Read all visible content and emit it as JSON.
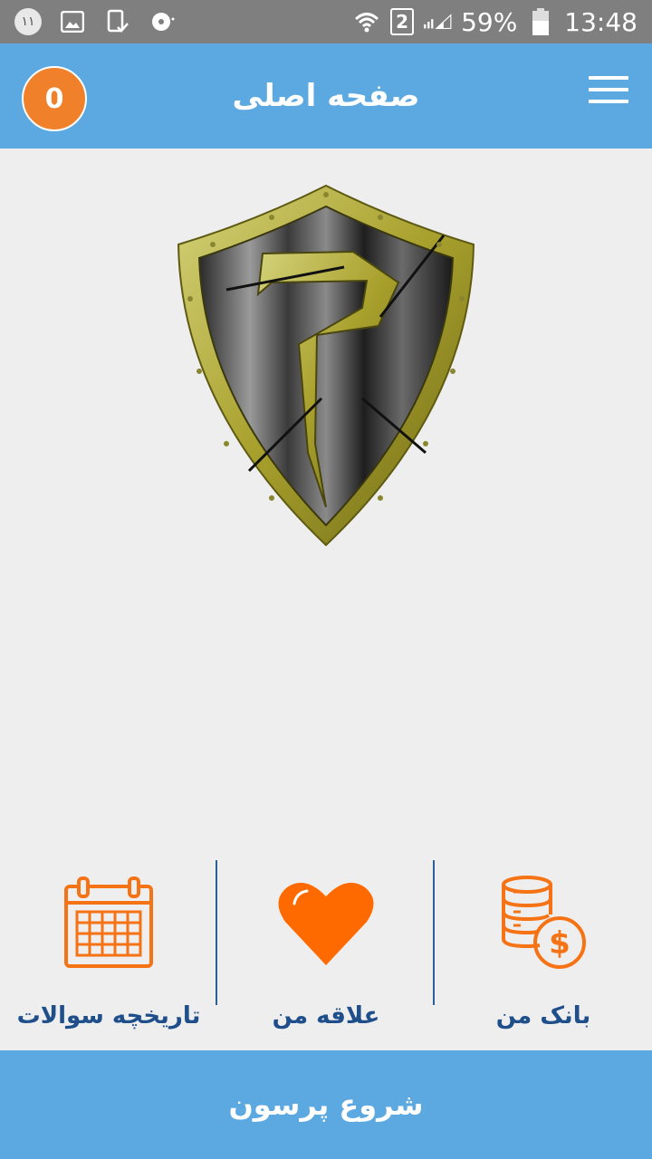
{
  "status_bar": {
    "notification_count": "۱۱",
    "sim_slot": "2",
    "battery": "59%",
    "time": "13:48"
  },
  "appbar": {
    "title": "صفحه اصلی",
    "coins": "0"
  },
  "actions": [
    {
      "label": "تاریخچه سوالات",
      "icon": "calendar-icon"
    },
    {
      "label": "علاقه من",
      "icon": "heart-icon"
    },
    {
      "label": "بانک من",
      "icon": "coins-dollar-icon"
    }
  ],
  "start_button": {
    "label": "شروع پرسون"
  },
  "colors": {
    "appbar": "#5ca8e0",
    "accent_orange": "#f0802a",
    "label_blue": "#1f4f8a"
  }
}
